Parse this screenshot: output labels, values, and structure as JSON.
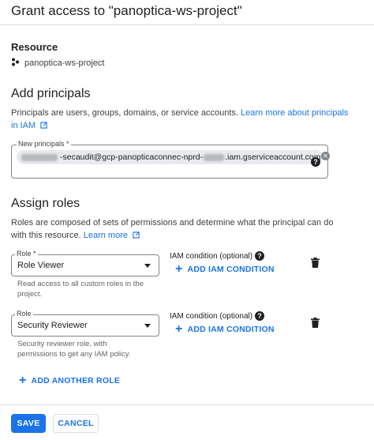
{
  "header": {
    "title": "Grant access to \"panoptica-ws-project\""
  },
  "resource": {
    "heading": "Resource",
    "name": "panoptica-ws-project",
    "icon": "project-icon"
  },
  "principals": {
    "heading": "Add principals",
    "description": "Principals are users, groups, domains, or service accounts.",
    "learn_more_link": "Learn more about principals",
    "learn_more_suffix": "in IAM",
    "field_label": "New principals *",
    "chip_visible_text": "-secaudit@gcp-panopticaconnec-nprd-",
    "chip_domain": ".iam.gserviceaccount.com"
  },
  "roles": {
    "heading": "Assign roles",
    "description_line1": "Roles are composed of sets of permissions and determine what the principal can do",
    "description_line2": "with this resource.",
    "learn_more": "Learn more",
    "items": [
      {
        "field_label": "Role *",
        "value": "Role Viewer",
        "hint_line1": "Read access to all custom roles in the",
        "hint_line2": "project.",
        "condition_label": "IAM condition (optional)",
        "condition_button": "ADD IAM CONDITION"
      },
      {
        "field_label": "Role",
        "value": "Security Reviewer",
        "hint_line1": "Security reviewer role, with",
        "hint_line2": "permissions to get any IAM policy.",
        "condition_label": "IAM condition (optional)",
        "condition_button": "ADD IAM CONDITION"
      }
    ],
    "add_another": "ADD ANOTHER ROLE"
  },
  "footer": {
    "save": "SAVE",
    "cancel": "CANCEL"
  },
  "colors": {
    "accent": "#1a73e8",
    "text": "#202124",
    "muted": "#5f6368",
    "border": "#dadce0"
  }
}
